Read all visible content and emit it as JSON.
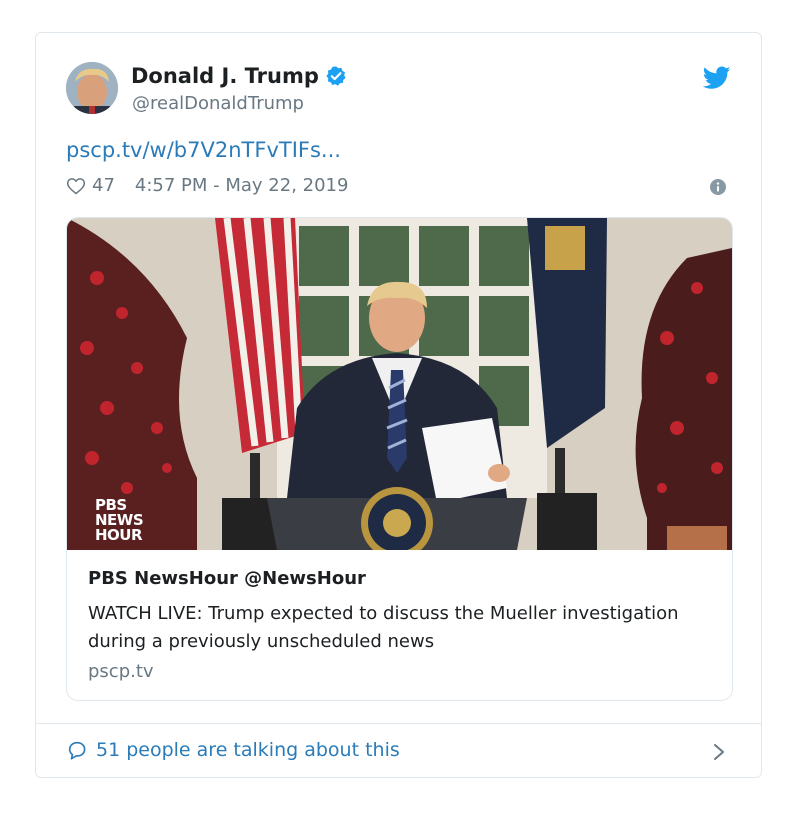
{
  "tweet": {
    "author_name": "Donald J. Trump",
    "author_handle": "@realDonaldTrump",
    "link_text": "pscp.tv/w/b7V2nTFvTIFs...",
    "likes": "47",
    "timestamp": "4:57 PM - May 22, 2019"
  },
  "media_card": {
    "title": "PBS NewsHour @NewsHour",
    "description": "WATCH LIVE: Trump expected to discuss the Mueller investigation during a previously unscheduled news",
    "domain": "pscp.tv",
    "watermark": [
      "PBS",
      "NEWS",
      "HOUR"
    ]
  },
  "footer": {
    "talking_text": "51 people are talking about this"
  },
  "icons": {
    "verified": "verified-badge-icon",
    "bird": "twitter-bird-icon",
    "heart": "heart-icon",
    "info": "info-icon",
    "bubble": "speech-bubble-icon",
    "chevron": "chevron-right-icon"
  },
  "colors": {
    "link": "#2b7bb9",
    "brand": "#1da1f2",
    "muted": "#697882",
    "border": "#e1e8ed"
  }
}
